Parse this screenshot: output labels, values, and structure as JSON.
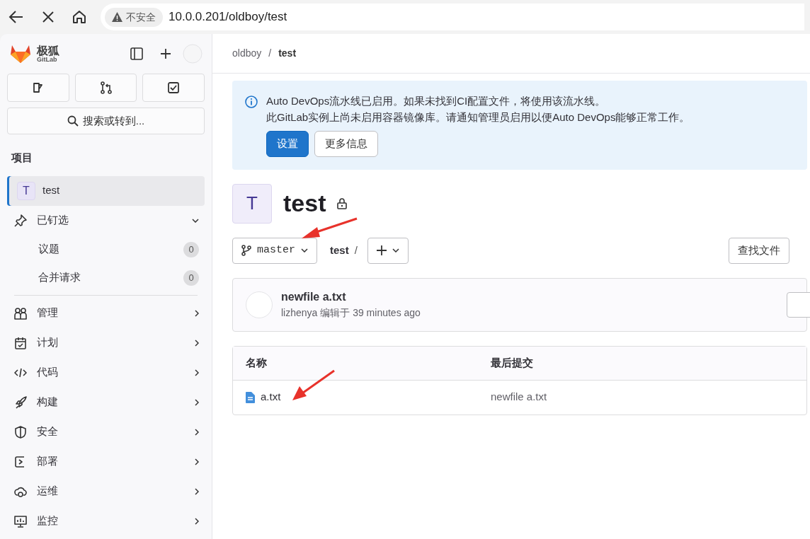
{
  "browser": {
    "security_label": "不安全",
    "url": "10.0.0.201/oldboy/test"
  },
  "sidebar": {
    "logo_text": "极狐",
    "logo_subtext": "GitLab",
    "search_label": "搜索或转到...",
    "section_title": "项目",
    "project": {
      "avatar": "T",
      "label": "test",
      "selected": true
    },
    "pinned": {
      "label": "已钉选",
      "expanded": true,
      "items": [
        {
          "label": "议题",
          "count": "0"
        },
        {
          "label": "合并请求",
          "count": "0"
        }
      ]
    },
    "nav_items": [
      {
        "label": "管理"
      },
      {
        "label": "计划"
      },
      {
        "label": "代码"
      },
      {
        "label": "构建"
      },
      {
        "label": "安全"
      },
      {
        "label": "部署"
      },
      {
        "label": "运维"
      },
      {
        "label": "监控"
      }
    ]
  },
  "breadcrumb": {
    "separator": "/",
    "items": [
      {
        "label": "oldboy",
        "current": false
      },
      {
        "label": "test",
        "current": true
      }
    ]
  },
  "alert": {
    "lines": [
      "Auto DevOps流水线已启用。如果未找到CI配置文件，将使用该流水线。",
      "此GitLab实例上尚未启用容器镜像库。请通知管理员启用以便Auto DevOps能够正常工作。"
    ],
    "primary_button": "设置",
    "secondary_button": "更多信息"
  },
  "project": {
    "avatar": "T",
    "name": "test",
    "private": true
  },
  "repo_bar": {
    "branch": "master",
    "path": "test",
    "path_separator": "/",
    "find_file": "查找文件"
  },
  "last_commit": {
    "title": "newfile a.txt",
    "author": "lizhenya",
    "action": "编辑于",
    "time": "39 minutes ago"
  },
  "file_table": {
    "columns": [
      "名称",
      "最后提交"
    ],
    "rows": [
      {
        "name": "a.txt",
        "last_commit": "newfile a.txt"
      }
    ]
  }
}
